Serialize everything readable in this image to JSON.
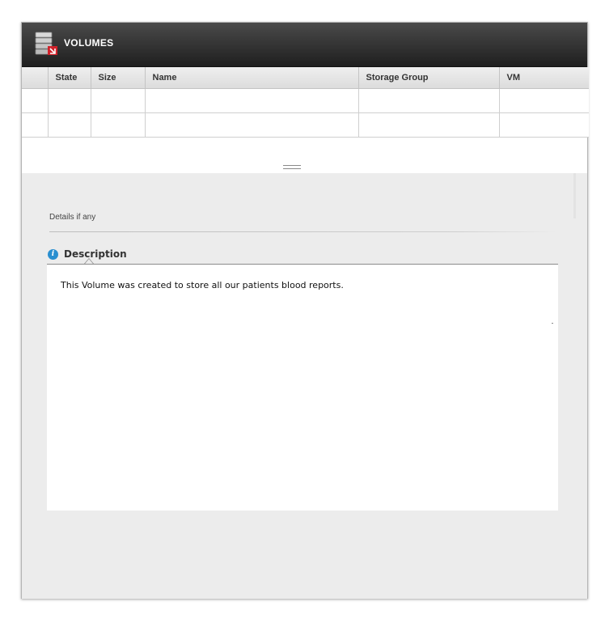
{
  "header": {
    "title": "VOLUMES",
    "icon": "database-icon",
    "accent_color": "#d0212a"
  },
  "table": {
    "columns": [
      "",
      "State",
      "Size",
      "Name",
      "Storage Group",
      "VM"
    ],
    "rows": [
      [
        "",
        "",
        "",
        "",
        "",
        ""
      ],
      [
        "",
        "",
        "",
        "",
        "",
        ""
      ]
    ]
  },
  "details": {
    "label": "Details if any",
    "tab_title": "Description",
    "tab_icon": "info-icon",
    "description_text": "This Volume was created to store all our patients blood reports."
  }
}
